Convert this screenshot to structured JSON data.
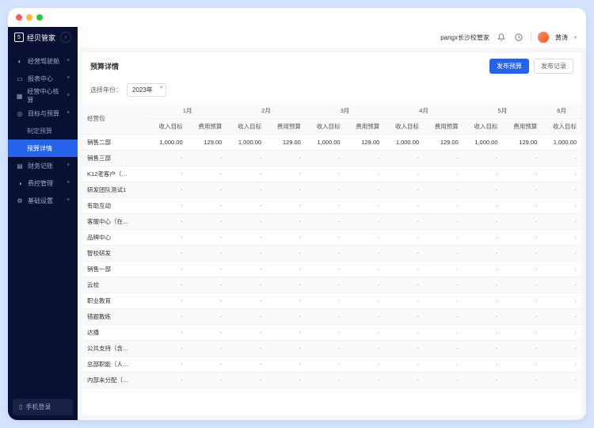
{
  "app_name": "经贝管家",
  "header": {
    "org_name": "pangx长沙校管家",
    "username": "黄涛"
  },
  "sidebar": {
    "items": [
      {
        "label": "经营驾驶舱",
        "icon": "◐"
      },
      {
        "label": "报表中心",
        "icon": "▭"
      },
      {
        "label": "经营中心核算",
        "icon": "▦"
      },
      {
        "label": "目标与预算",
        "icon": "◎",
        "expanded": true,
        "children": [
          {
            "label": "制定预算"
          },
          {
            "label": "预算详情",
            "active": true
          }
        ]
      },
      {
        "label": "财务记账",
        "icon": "▤"
      },
      {
        "label": "费控管理",
        "icon": "◑"
      },
      {
        "label": "基础设置",
        "icon": "⚙"
      }
    ],
    "mobile_login": "手机登录"
  },
  "page": {
    "title": "预算详情",
    "publish_btn": "发布预算",
    "records_btn": "发布记录",
    "filter_label": "选择年份：",
    "year_value": "2023年"
  },
  "table": {
    "group_header": "经营包",
    "months": [
      "1月",
      "2月",
      "3月",
      "4月",
      "5月",
      "6月"
    ],
    "sub_headers": [
      "收入目标",
      "费用预算"
    ],
    "rows": [
      {
        "name": "销售二部",
        "values": [
          "1,000.00",
          "129.00",
          "1,000.00",
          "129.00",
          "1,000.00",
          "129.00",
          "1,000.00",
          "129.00",
          "1,000.00",
          "129.00",
          "1,000.00"
        ]
      },
      {
        "name": "销售三部",
        "values": [
          "-",
          "-",
          "-",
          "-",
          "-",
          "-",
          "-",
          "-",
          "-",
          "-",
          "-"
        ]
      },
      {
        "name": "K12老客户（…",
        "values": [
          "-",
          "-",
          "-",
          "-",
          "-",
          "-",
          "-",
          "-",
          "-",
          "-",
          "-"
        ]
      },
      {
        "name": "研发团队测试1",
        "values": [
          "-",
          "-",
          "-",
          "-",
          "-",
          "-",
          "-",
          "-",
          "-",
          "-",
          "-"
        ]
      },
      {
        "name": "有助互动",
        "values": [
          "-",
          "-",
          "-",
          "-",
          "-",
          "-",
          "-",
          "-",
          "-",
          "-",
          "-"
        ]
      },
      {
        "name": "客服中心（在…",
        "values": [
          "-",
          "-",
          "-",
          "-",
          "-",
          "-",
          "-",
          "-",
          "-",
          "-",
          "-"
        ]
      },
      {
        "name": "品牌中心",
        "values": [
          "-",
          "-",
          "-",
          "-",
          "-",
          "-",
          "-",
          "-",
          "-",
          "-",
          "-"
        ]
      },
      {
        "name": "智校研发",
        "values": [
          "-",
          "-",
          "-",
          "-",
          "-",
          "-",
          "-",
          "-",
          "-",
          "-",
          "-"
        ]
      },
      {
        "name": "销售一部",
        "values": [
          "-",
          "-",
          "-",
          "-",
          "-",
          "-",
          "-",
          "-",
          "-",
          "-",
          "-"
        ]
      },
      {
        "name": "云校",
        "values": [
          "-",
          "-",
          "-",
          "-",
          "-",
          "-",
          "-",
          "-",
          "-",
          "-",
          "-"
        ]
      },
      {
        "name": "职业教育",
        "values": [
          "-",
          "-",
          "-",
          "-",
          "-",
          "-",
          "-",
          "-",
          "-",
          "-",
          "-"
        ]
      },
      {
        "name": "错题教练",
        "values": [
          "-",
          "-",
          "-",
          "-",
          "-",
          "-",
          "-",
          "-",
          "-",
          "-",
          "-"
        ]
      },
      {
        "name": "达播",
        "values": [
          "-",
          "-",
          "-",
          "-",
          "-",
          "-",
          "-",
          "-",
          "-",
          "-",
          "-"
        ]
      },
      {
        "name": "公共支持（含…",
        "values": [
          "-",
          "-",
          "-",
          "-",
          "-",
          "-",
          "-",
          "-",
          "-",
          "-",
          "-"
        ]
      },
      {
        "name": "总部职能（人…",
        "values": [
          "-",
          "-",
          "-",
          "-",
          "-",
          "-",
          "-",
          "-",
          "-",
          "-",
          "-"
        ]
      },
      {
        "name": "内部未分配（…",
        "values": [
          "-",
          "-",
          "-",
          "-",
          "-",
          "-",
          "-",
          "-",
          "-",
          "-",
          "-"
        ]
      }
    ]
  }
}
